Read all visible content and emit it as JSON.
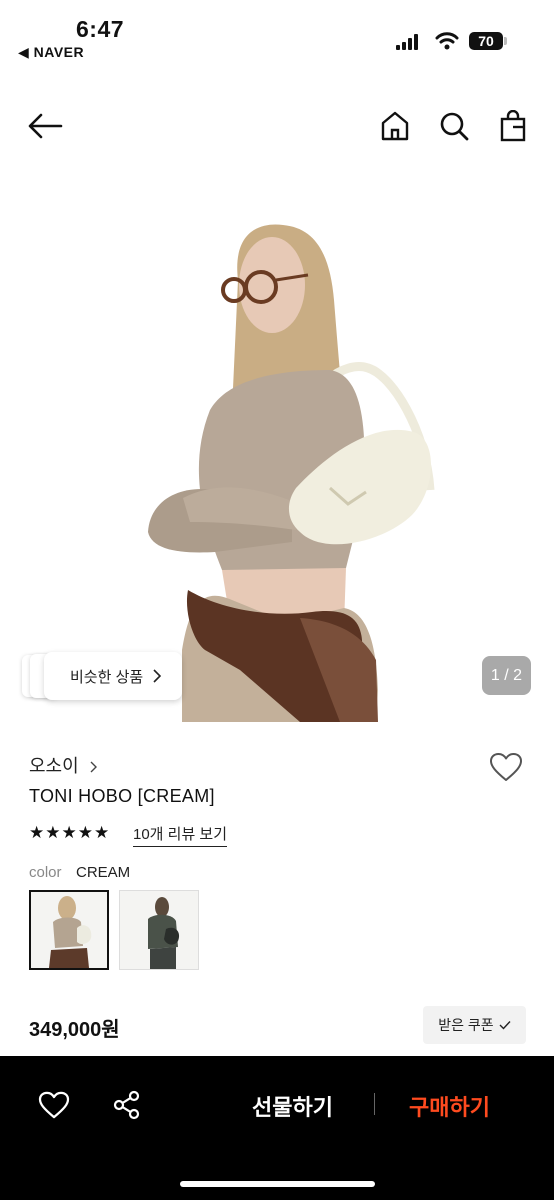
{
  "status_bar": {
    "time": "6:47",
    "back_app": "◀ NAVER",
    "battery": "70"
  },
  "nav": {
    "back_icon": "arrow-left-icon",
    "home_icon": "home-icon",
    "search_icon": "search-icon",
    "bag_icon": "shopping-bag-icon"
  },
  "hero": {
    "similar_label": "비슷한 상품",
    "pager": "1 / 2"
  },
  "product": {
    "brand": "오소이",
    "title": "TONI HOBO [CREAM]",
    "stars": "★★★★★",
    "review_link": "10개 리뷰 보기",
    "color_label": "color",
    "color_value": "CREAM",
    "price": "349,000원",
    "coupon_label": "받은 쿠폰"
  },
  "bottom_bar": {
    "gift_label": "선물하기",
    "buy_label": "구매하기"
  },
  "colors": {
    "accent": "#ff4b1f",
    "bar_bg": "#000000",
    "pager_bg": "#a9a9a9"
  }
}
